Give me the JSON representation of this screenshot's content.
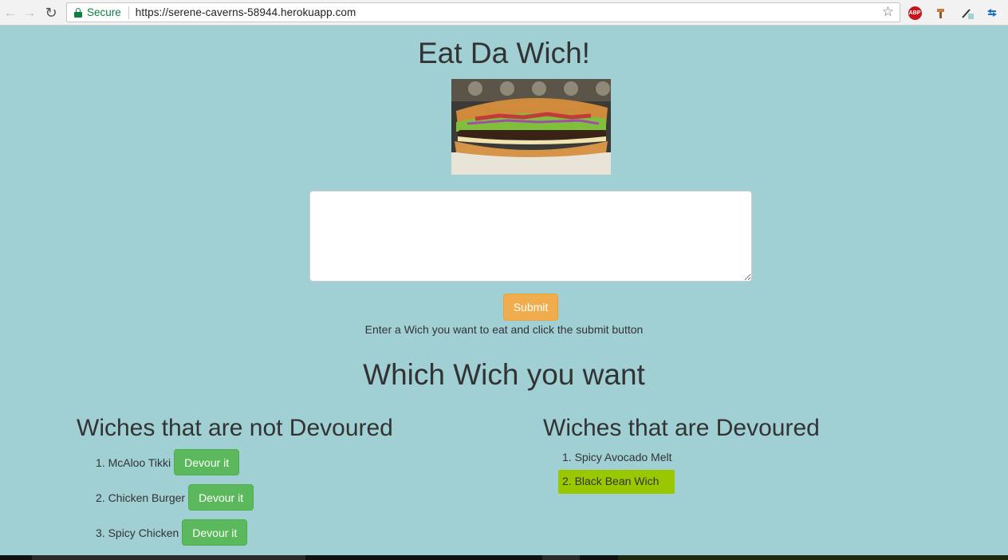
{
  "browser": {
    "secure_label": "Secure",
    "url": "https://serene-caverns-58944.herokuapp.com",
    "extensions": {
      "abp_label": "ABP"
    }
  },
  "page": {
    "title": "Eat Da Wich!",
    "input": {
      "value": "",
      "placeholder": ""
    },
    "submit_label": "Submit",
    "helper_text": "Enter a Wich you want to eat and click the submit button",
    "subtitle": "Which Wich you want",
    "not_devoured": {
      "heading": "Wiches that are not Devoured",
      "button_label": "Devour it",
      "items": [
        {
          "label": "1. McAloo Tikki"
        },
        {
          "label": "2. Chicken Burger"
        },
        {
          "label": "3. Spicy Chicken"
        }
      ]
    },
    "devoured": {
      "heading": "Wiches that are Devoured",
      "items": [
        {
          "label": "1. Spicy Avocado Melt"
        },
        {
          "label": "2. Black Bean Wich"
        }
      ]
    }
  },
  "colors": {
    "page_bg": "#a0cfd4",
    "submit_bg": "#f0ad4e",
    "devour_bg": "#5cb85c",
    "highlight": "#9ac800",
    "secure_green": "#0b8043"
  }
}
